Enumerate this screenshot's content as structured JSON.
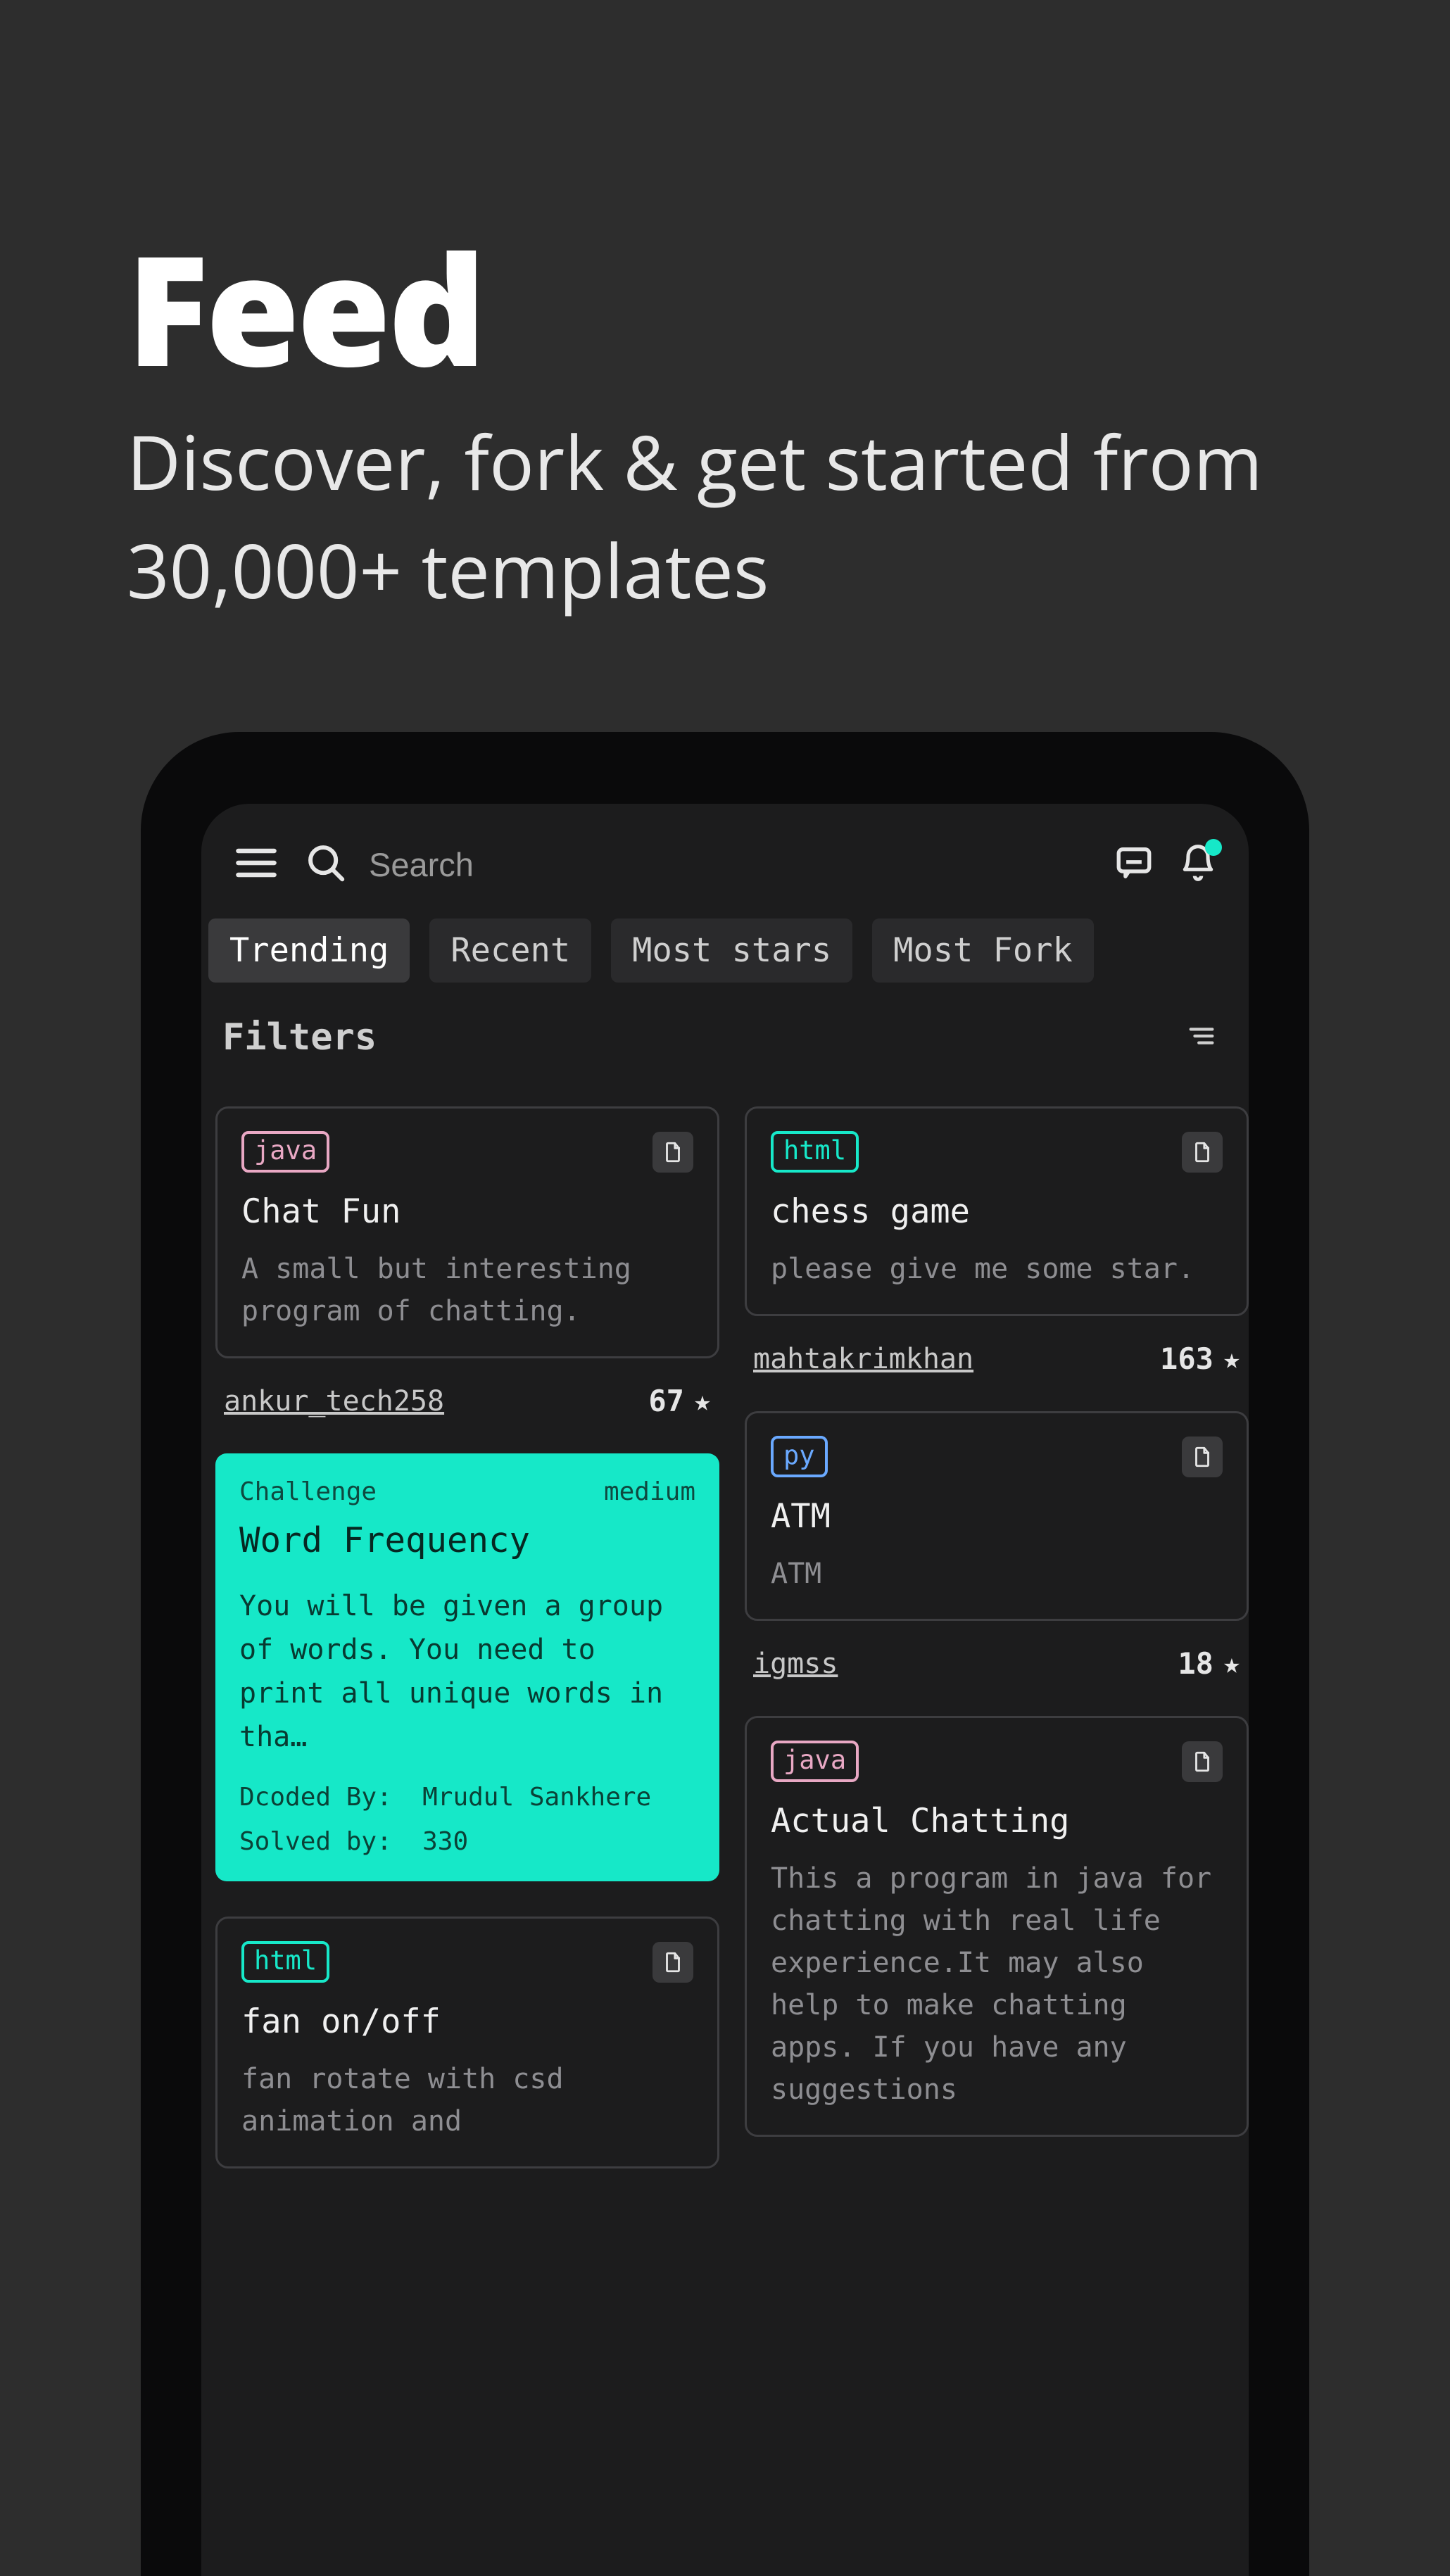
{
  "promo": {
    "title": "Feed",
    "subtitle": "Discover, fork & get started from 30,000+ templates"
  },
  "search": {
    "placeholder": "Search"
  },
  "tabs": [
    "Trending",
    "Recent",
    "Most stars",
    "Most Fork"
  ],
  "filters_label": "Filters",
  "left_col": {
    "card0": {
      "lang": "java",
      "title": "Chat Fun",
      "desc": "A small but interesting program of chatting.",
      "author": "ankur_tech258",
      "stars": "67"
    },
    "challenge": {
      "tag": "Challenge",
      "level": "medium",
      "title": "Word Frequency",
      "desc": "You will be given a group of words. You need to print all unique words in tha…",
      "dcoded_label": "Dcoded By:",
      "dcoded_by": "Mrudul Sankhere",
      "solved_label": "Solved by:",
      "solved_by": "330"
    },
    "card1": {
      "lang": "html",
      "title": "fan on/off",
      "desc": "fan rotate with csd animation and"
    }
  },
  "right_col": {
    "card0": {
      "lang": "html",
      "title": "chess game",
      "desc": "please give me some star.",
      "author": "mahtakrimkhan",
      "stars": "163"
    },
    "card1": {
      "lang": "py",
      "title": "ATM",
      "desc": "ATM",
      "author": "igmss",
      "stars": "18"
    },
    "card2": {
      "lang": "java",
      "title": "Actual Chatting",
      "desc": "This a program in java for chatting with real life experience.It may also help to make chatting apps. If you have any suggestions"
    }
  }
}
